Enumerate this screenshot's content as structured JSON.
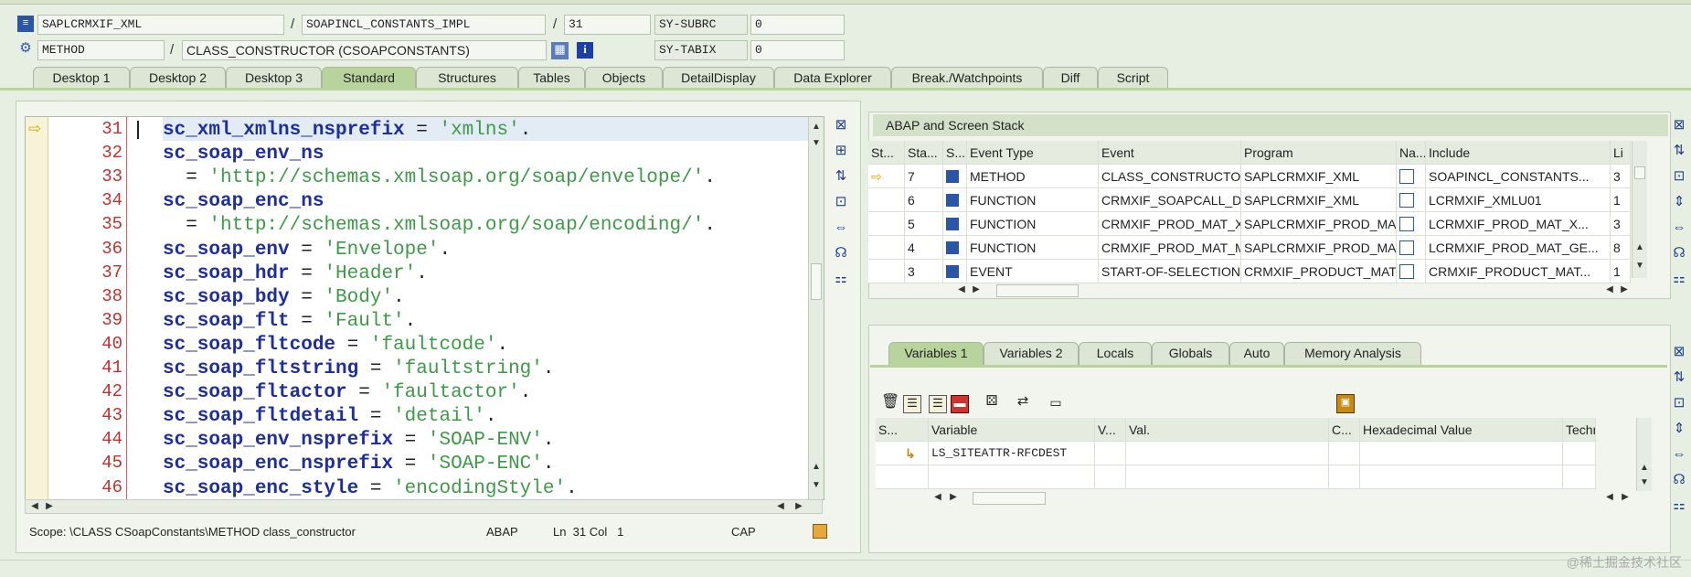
{
  "header": {
    "program": "SAPLCRMXIF_XML",
    "include": "SOAPINCL_CONSTANTS_IMPL",
    "line": "31",
    "sysvar1_name": "SY-SUBRC",
    "sysvar1_value": "0",
    "event_type": "METHOD",
    "event": "CLASS_CONSTRUCTOR (CSOAPCONSTANTS)",
    "sysvar2_name": "SY-TABIX",
    "sysvar2_value": "0",
    "separator": "/"
  },
  "tabs": [
    {
      "label": "Desktop 1"
    },
    {
      "label": "Desktop 2"
    },
    {
      "label": "Desktop 3"
    },
    {
      "label": "Standard"
    },
    {
      "label": "Structures"
    },
    {
      "label": "Tables"
    },
    {
      "label": "Objects"
    },
    {
      "label": "DetailDisplay"
    },
    {
      "label": "Data Explorer"
    },
    {
      "label": "Break./Watchpoints"
    },
    {
      "label": "Diff"
    },
    {
      "label": "Script"
    }
  ],
  "editor": {
    "current_marker": "⇨",
    "lines": [
      {
        "n": "31",
        "tokens": [
          [
            "kw",
            "sc_xml_xmlns_nsprefix"
          ],
          [
            "op",
            " = "
          ],
          [
            "str",
            "'xmlns'"
          ],
          [
            "op",
            "."
          ]
        ]
      },
      {
        "n": "32",
        "tokens": [
          [
            "kw",
            "sc_soap_env_ns"
          ]
        ]
      },
      {
        "n": "33",
        "tokens": [
          [
            "op",
            "  = "
          ],
          [
            "str",
            "'http://schemas.xmlsoap.org/soap/envelope/'"
          ],
          [
            "op",
            "."
          ]
        ]
      },
      {
        "n": "34",
        "tokens": [
          [
            "kw",
            "sc_soap_enc_ns"
          ]
        ]
      },
      {
        "n": "35",
        "tokens": [
          [
            "op",
            "  = "
          ],
          [
            "str",
            "'http://schemas.xmlsoap.org/soap/encoding/'"
          ],
          [
            "op",
            "."
          ]
        ]
      },
      {
        "n": "36",
        "tokens": [
          [
            "kw",
            "sc_soap_env"
          ],
          [
            "op",
            " = "
          ],
          [
            "str",
            "'Envelope'"
          ],
          [
            "op",
            "."
          ]
        ]
      },
      {
        "n": "37",
        "tokens": [
          [
            "kw",
            "sc_soap_hdr"
          ],
          [
            "op",
            " = "
          ],
          [
            "str",
            "'Header'"
          ],
          [
            "op",
            "."
          ]
        ]
      },
      {
        "n": "38",
        "tokens": [
          [
            "kw",
            "sc_soap_bdy"
          ],
          [
            "op",
            " = "
          ],
          [
            "str",
            "'Body'"
          ],
          [
            "op",
            "."
          ]
        ]
      },
      {
        "n": "39",
        "tokens": [
          [
            "kw",
            "sc_soap_flt"
          ],
          [
            "op",
            " = "
          ],
          [
            "str",
            "'Fault'"
          ],
          [
            "op",
            "."
          ]
        ]
      },
      {
        "n": "40",
        "tokens": [
          [
            "kw",
            "sc_soap_fltcode"
          ],
          [
            "op",
            " = "
          ],
          [
            "str",
            "'faultcode'"
          ],
          [
            "op",
            "."
          ]
        ]
      },
      {
        "n": "41",
        "tokens": [
          [
            "kw",
            "sc_soap_fltstring"
          ],
          [
            "op",
            " = "
          ],
          [
            "str",
            "'faultstring'"
          ],
          [
            "op",
            "."
          ]
        ]
      },
      {
        "n": "42",
        "tokens": [
          [
            "kw",
            "sc_soap_fltactor"
          ],
          [
            "op",
            " = "
          ],
          [
            "str",
            "'faultactor'"
          ],
          [
            "op",
            "."
          ]
        ]
      },
      {
        "n": "43",
        "tokens": [
          [
            "kw",
            "sc_soap_fltdetail"
          ],
          [
            "op",
            " = "
          ],
          [
            "str",
            "'detail'"
          ],
          [
            "op",
            "."
          ]
        ]
      },
      {
        "n": "44",
        "tokens": [
          [
            "kw",
            "sc_soap_env_nsprefix"
          ],
          [
            "op",
            " = "
          ],
          [
            "str",
            "'SOAP-ENV'"
          ],
          [
            "op",
            "."
          ]
        ]
      },
      {
        "n": "45",
        "tokens": [
          [
            "kw",
            "sc_soap_enc_nsprefix"
          ],
          [
            "op",
            " = "
          ],
          [
            "str",
            "'SOAP-ENC'"
          ],
          [
            "op",
            "."
          ]
        ]
      },
      {
        "n": "46",
        "tokens": [
          [
            "kw",
            "sc_soap_enc_style"
          ],
          [
            "op",
            " = "
          ],
          [
            "str",
            "'encodingStyle'"
          ],
          [
            "op",
            "."
          ]
        ]
      }
    ]
  },
  "status": {
    "scope": "Scope: \\CLASS CSoapConstants\\METHOD class_constructor",
    "lang": "ABAP",
    "position": "Ln  31 Col   1",
    "caps": "CAP"
  },
  "stack": {
    "title": "ABAP and Screen Stack",
    "columns": [
      "St...",
      "Sta...",
      "S...",
      "Event Type",
      "Event",
      "Program",
      "Na...",
      "Include",
      "Li"
    ],
    "rows": [
      {
        "marker": "⇨",
        "level": "7",
        "type": "METHOD",
        "event": "CLASS_CONSTRUCTOR",
        "program": "SAPLCRMXIF_XML",
        "include": "SOAPINCL_CONSTANTS...",
        "line": "3"
      },
      {
        "marker": "",
        "level": "6",
        "type": "FUNCTION",
        "event": "CRMXIF_SOAPCALL_DO",
        "program": "SAPLCRMXIF_XML",
        "include": "LCRMXIF_XMLU01",
        "line": "1"
      },
      {
        "marker": "",
        "level": "5",
        "type": "FUNCTION",
        "event": "CRMXIF_PROD_MAT_XM...",
        "program": "SAPLCRMXIF_PROD_MAT...",
        "include": "LCRMXIF_PROD_MAT_X...",
        "line": "3"
      },
      {
        "marker": "",
        "level": "4",
        "type": "FUNCTION",
        "event": "CRMXIF_PROD_MAT_MA...",
        "program": "SAPLCRMXIF_PROD_MAT...",
        "include": "LCRMXIF_PROD_MAT_GE...",
        "line": "8"
      },
      {
        "marker": "",
        "level": "3",
        "type": "EVENT",
        "event": "START-OF-SELECTION",
        "program": "CRMXIF_PRODUCT_MAT...",
        "include": "CRMXIF_PRODUCT_MAT...",
        "line": "1"
      }
    ]
  },
  "vartabs": [
    {
      "label": "Variables 1"
    },
    {
      "label": "Variables 2"
    },
    {
      "label": "Locals"
    },
    {
      "label": "Globals"
    },
    {
      "label": "Auto"
    },
    {
      "label": "Memory Analysis"
    }
  ],
  "variables": {
    "columns": [
      "S...",
      "Variable",
      "V...",
      "Val.",
      "C...",
      "Hexadecimal Value",
      "Technical T"
    ],
    "rows": [
      {
        "variable": "LS_SITEATTR-RFCDEST"
      }
    ]
  },
  "watermark": "@稀土掘金技术社区",
  "colors": {
    "accent": "#b8d39c",
    "keyword": "#1e2f9c",
    "string": "#3d9a46",
    "linenum": "#c0302e"
  }
}
